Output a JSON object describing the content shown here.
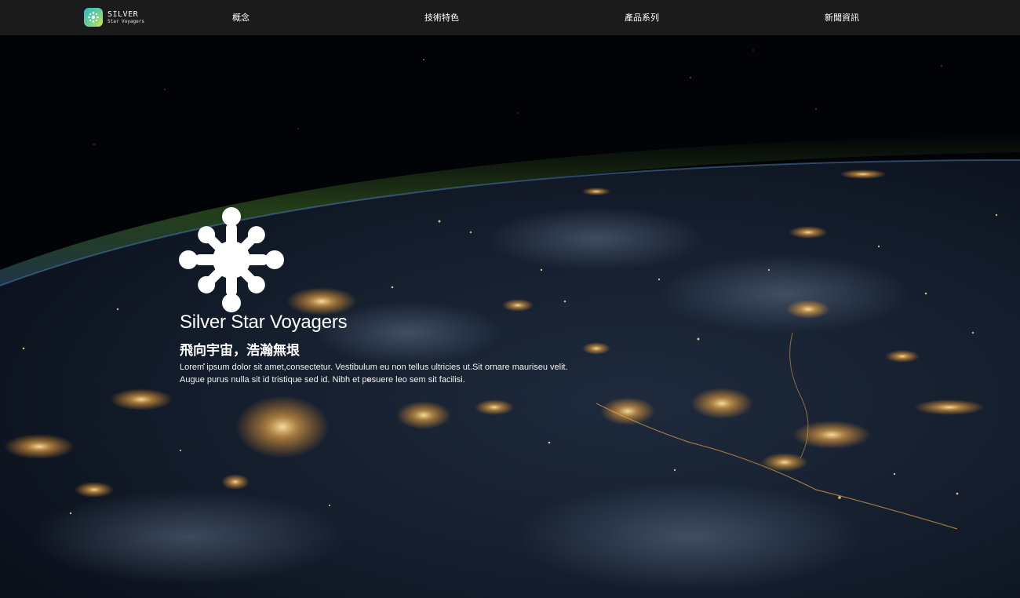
{
  "brand": {
    "name": "SILVER",
    "tagline": "Star Voyagers",
    "logo_icon": "snowflake-burst-icon",
    "gradient_colors": [
      "#2bb8c8",
      "#6fcf8f",
      "#d8e64a"
    ]
  },
  "nav": {
    "items": [
      {
        "label": "概念"
      },
      {
        "label": "技術特色"
      },
      {
        "label": "產品系列"
      },
      {
        "label": "新聞資訊"
      }
    ]
  },
  "hero": {
    "background": "earth-at-night-from-orbit",
    "logo_icon": "splash-flower-icon",
    "title": "Silver Star Voyagers",
    "subtitle": "飛向宇宙，浩瀚無垠",
    "description": [
      "Lorem ipsum dolor sit amet,consectetur. Vestibulum eu non tellus ultricies ut.Sit ornare mauriseu velit.",
      "Augue purus nulla sit id tristique sed id. Nibh et posuere leo sem sit facilisi."
    ]
  },
  "colors": {
    "navbar_bg": "#1b1b1b",
    "text": "#ffffff",
    "city_lights": "#ffb347",
    "atmosphere": "#3d6b2a"
  }
}
